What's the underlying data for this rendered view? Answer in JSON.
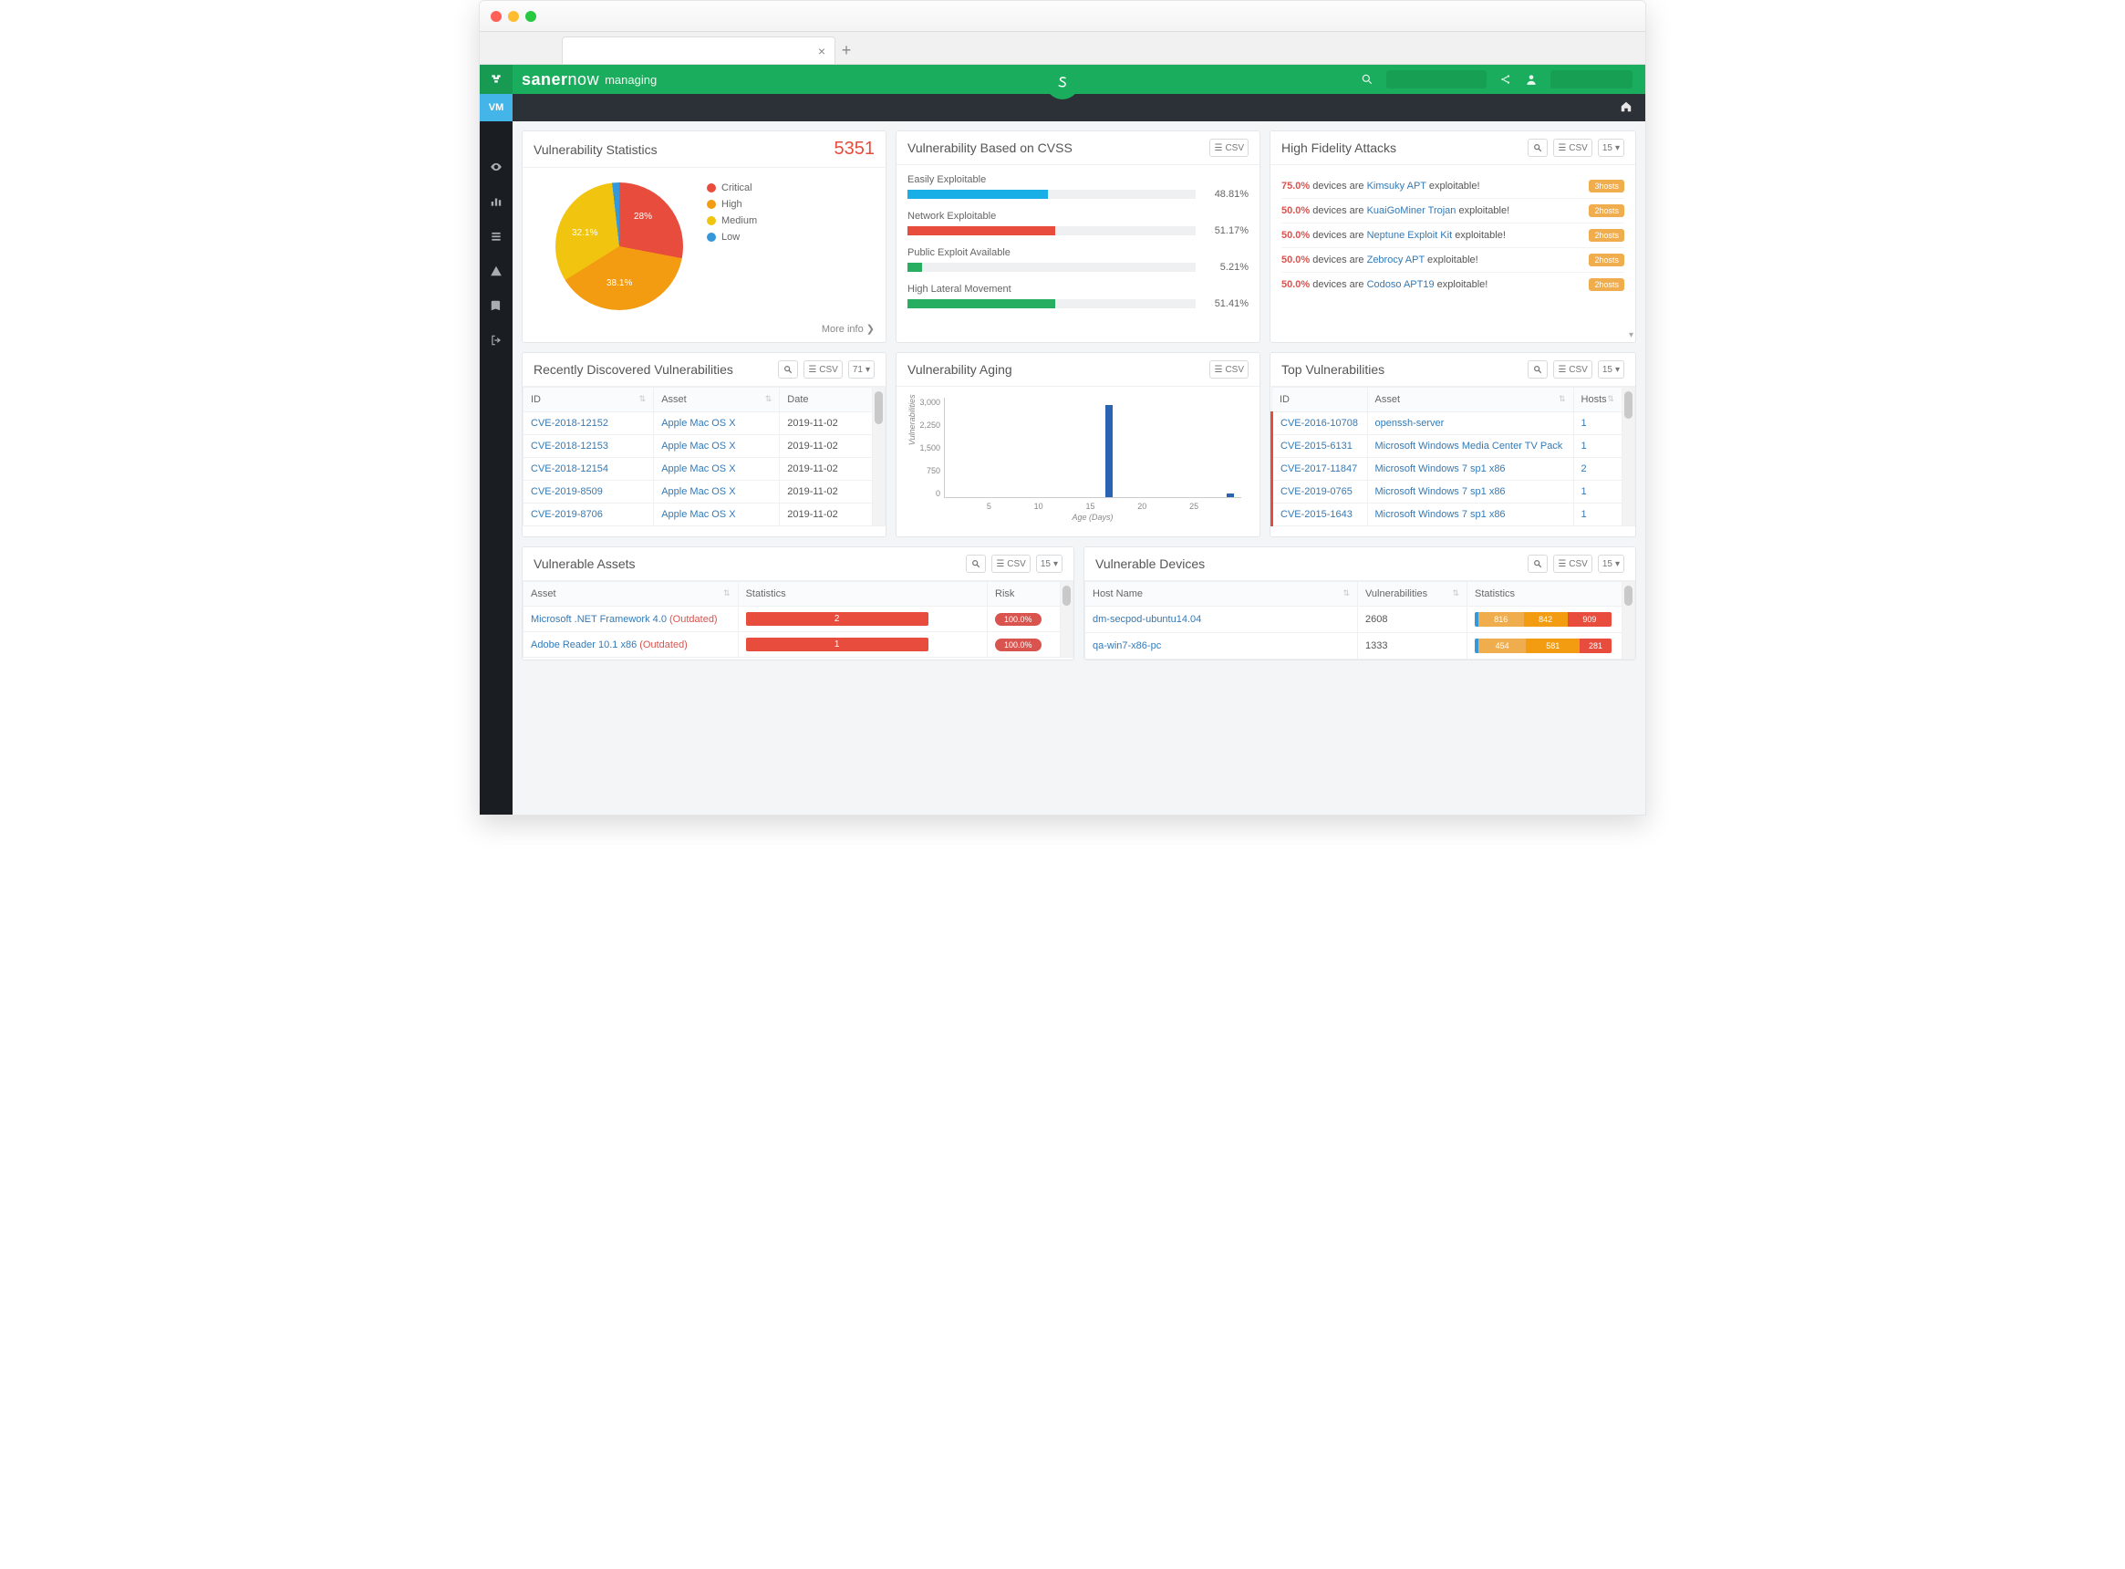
{
  "header": {
    "brand_a": "saner",
    "brand_b": "now",
    "managing": "managing"
  },
  "vm_badge": "VM",
  "vuln_stats": {
    "title": "Vulnerability Statistics",
    "count": "5351",
    "legend": {
      "critical": "Critical",
      "high": "High",
      "medium": "Medium",
      "low": "Low"
    },
    "pie": {
      "p28": "28%",
      "p381": "38.1%",
      "p321": "32.1%"
    },
    "more": "More info"
  },
  "cvss": {
    "title": "Vulnerability Based on CVSS",
    "csv": "CSV",
    "rows": [
      {
        "label": "Easily Exploitable",
        "pct": "48.81%",
        "w": 48.81,
        "color": "#18aee6"
      },
      {
        "label": "Network Exploitable",
        "pct": "51.17%",
        "w": 51.17,
        "color": "#e74c3c"
      },
      {
        "label": "Public Exploit Available",
        "pct": "5.21%",
        "w": 5.21,
        "color": "#27ae60"
      },
      {
        "label": "High Lateral Movement",
        "pct": "51.41%",
        "w": 51.41,
        "color": "#27ae60"
      }
    ]
  },
  "hifi": {
    "title": "High Fidelity Attacks",
    "csv": "CSV",
    "page": "15",
    "pre": "devices are",
    "suf": "exploitable!",
    "rows": [
      {
        "pct": "75.0%",
        "name": "Kimsuky APT",
        "hosts": "3hosts"
      },
      {
        "pct": "50.0%",
        "name": "KuaiGoMiner Trojan",
        "hosts": "2hosts"
      },
      {
        "pct": "50.0%",
        "name": "Neptune Exploit Kit",
        "hosts": "2hosts"
      },
      {
        "pct": "50.0%",
        "name": "Zebrocy APT",
        "hosts": "2hosts"
      },
      {
        "pct": "50.0%",
        "name": "Codoso APT19",
        "hosts": "2hosts"
      }
    ]
  },
  "recent": {
    "title": "Recently Discovered Vulnerabilities",
    "csv": "CSV",
    "page": "71",
    "cols": {
      "id": "ID",
      "asset": "Asset",
      "date": "Date"
    },
    "rows": [
      {
        "id": "CVE-2018-12152",
        "asset": "Apple Mac OS X",
        "date": "2019-11-02"
      },
      {
        "id": "CVE-2018-12153",
        "asset": "Apple Mac OS X",
        "date": "2019-11-02"
      },
      {
        "id": "CVE-2018-12154",
        "asset": "Apple Mac OS X",
        "date": "2019-11-02"
      },
      {
        "id": "CVE-2019-8509",
        "asset": "Apple Mac OS X",
        "date": "2019-11-02"
      },
      {
        "id": "CVE-2019-8706",
        "asset": "Apple Mac OS X",
        "date": "2019-11-02"
      }
    ]
  },
  "aging": {
    "title": "Vulnerability Aging",
    "csv": "CSV",
    "ylabel": "Vulnerabilities",
    "xlabel": "Age (Days)",
    "yticks": [
      "3,000",
      "2,250",
      "1,500",
      "750",
      "0"
    ],
    "xticks": [
      "5",
      "10",
      "15",
      "20",
      "25"
    ]
  },
  "topv": {
    "title": "Top Vulnerabilities",
    "csv": "CSV",
    "page": "15",
    "cols": {
      "id": "ID",
      "asset": "Asset",
      "hosts": "Hosts"
    },
    "rows": [
      {
        "id": "CVE-2016-10708",
        "asset": "openssh-server",
        "hosts": "1"
      },
      {
        "id": "CVE-2015-6131",
        "asset": "Microsoft Windows Media Center TV Pack",
        "hosts": "1"
      },
      {
        "id": "CVE-2017-11847",
        "asset": "Microsoft Windows 7 sp1 x86",
        "hosts": "2"
      },
      {
        "id": "CVE-2019-0765",
        "asset": "Microsoft Windows 7 sp1 x86",
        "hosts": "1"
      },
      {
        "id": "CVE-2015-1643",
        "asset": "Microsoft Windows 7 sp1 x86",
        "hosts": "1"
      }
    ]
  },
  "vassets": {
    "title": "Vulnerable Assets",
    "csv": "CSV",
    "page": "15",
    "cols": {
      "asset": "Asset",
      "stats": "Statistics",
      "risk": "Risk"
    },
    "outdated": "(Outdated)",
    "rows": [
      {
        "asset": "Microsoft .NET Framework 4.0",
        "stat": "2",
        "risk": "100.0%"
      },
      {
        "asset": "Adobe Reader 10.1 x86",
        "stat": "1",
        "risk": "100.0%"
      }
    ]
  },
  "vdev": {
    "title": "Vulnerable Devices",
    "csv": "CSV",
    "page": "15",
    "cols": {
      "host": "Host Name",
      "vuln": "Vulnerabilities",
      "stats": "Statistics"
    },
    "rows": [
      {
        "host": "dm-secpod-ubuntu14.04",
        "vuln": "2608",
        "s": [
          {
            "v": "816",
            "c": "#f0ad4e",
            "w": 34
          },
          {
            "v": "842",
            "c": "#f39c12",
            "w": 33
          },
          {
            "v": "909",
            "c": "#e74c3c",
            "w": 33
          }
        ]
      },
      {
        "host": "qa-win7-x86-pc",
        "vuln": "1333",
        "s": [
          {
            "v": "454",
            "c": "#f0ad4e",
            "w": 36
          },
          {
            "v": "581",
            "c": "#f39c12",
            "w": 40
          },
          {
            "v": "281",
            "c": "#e74c3c",
            "w": 24
          }
        ]
      }
    ]
  },
  "chart_data": {
    "type": "bar",
    "title": "Vulnerability Aging",
    "xlabel": "Age (Days)",
    "ylabel": "Vulnerabilities",
    "x": [
      17,
      28
    ],
    "values": [
      2800,
      120
    ],
    "ylim": [
      0,
      3000
    ]
  }
}
